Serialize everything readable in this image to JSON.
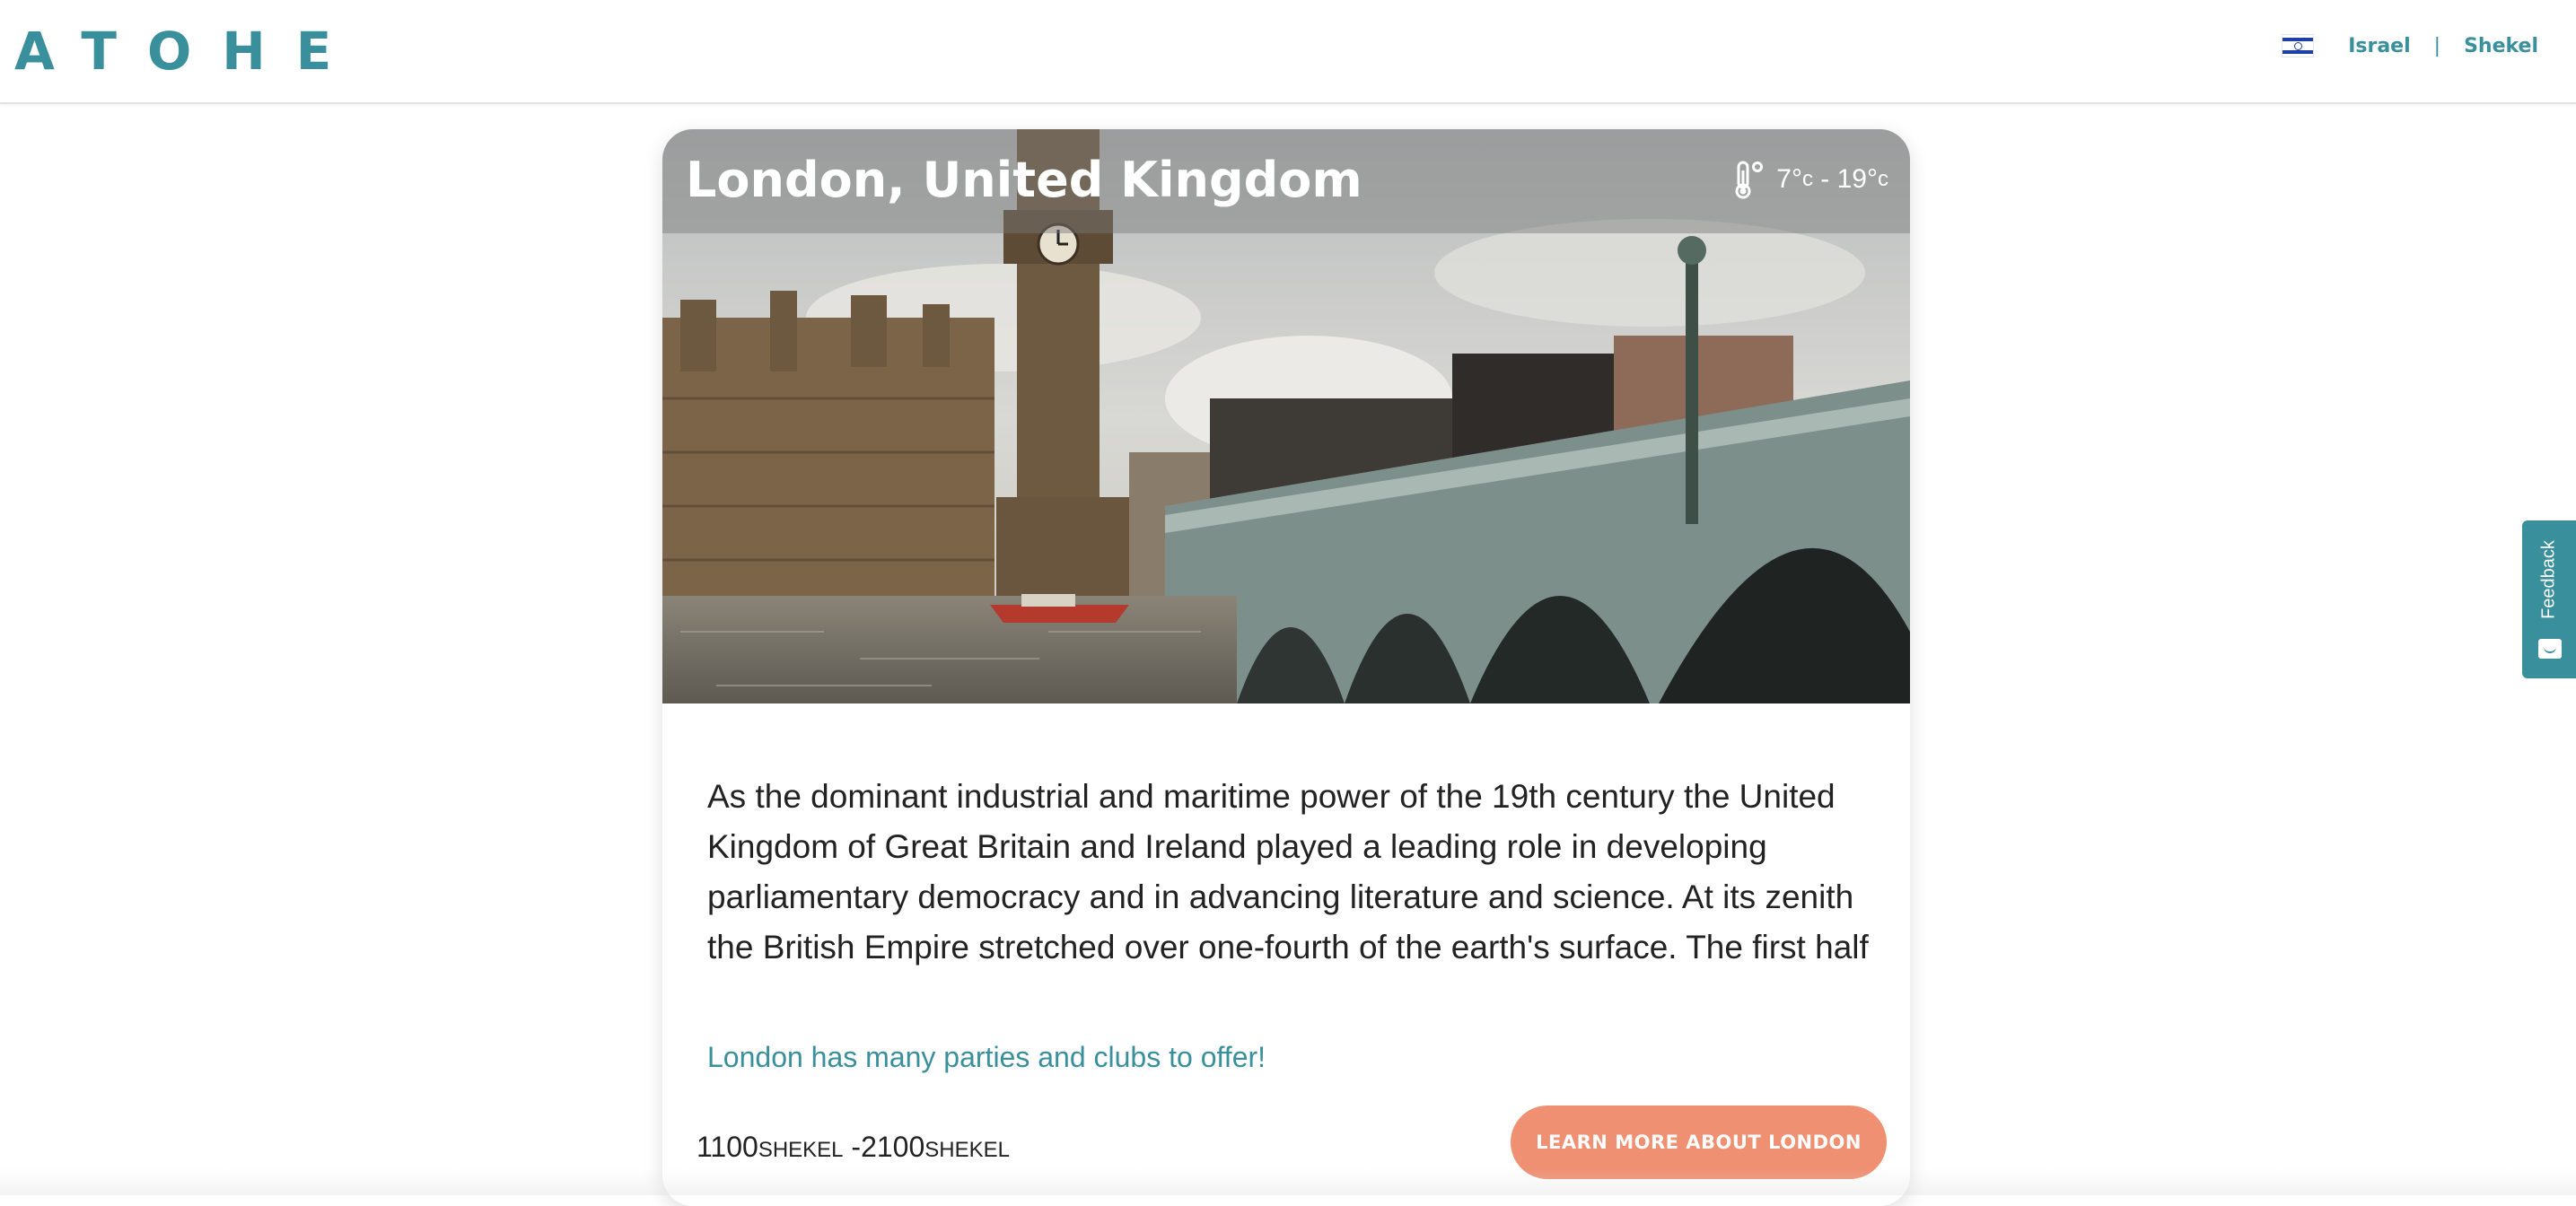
{
  "header": {
    "logo": "ATOHE",
    "flag_icon": "israel-flag-icon",
    "country": "Israel",
    "separator": "|",
    "currency": "Shekel"
  },
  "card": {
    "city": "London, United Kingdom",
    "temperature": {
      "icon": "thermometer-icon",
      "min": "7°",
      "min_unit": "c",
      "dash": " - ",
      "max": "19°",
      "max_unit": "c"
    },
    "image_alt": "Westminster Bridge and Big Ben over the River Thames",
    "description": "As the dominant industrial and maritime power of the 19th century the United Kingdom of Great Britain and Ireland played a leading role in developing parliamentary democracy and in advancing literature and science. At its zenith the British Empire stretched over one-fourth of the earth's surface. The first half of the…",
    "tagline": "London has many parties and clubs to offer!",
    "price": {
      "min": "1100",
      "min_currency": "Shekel",
      "separator": " -",
      "max": "2100",
      "max_currency": "Shekel"
    },
    "cta_label": "LEARN MORE ABOUT LONDON"
  },
  "feedback": {
    "label": "Feedback",
    "icon": "feedback-face-icon"
  },
  "colors": {
    "brand": "#3a8f9c",
    "cta": "#ef9073"
  }
}
